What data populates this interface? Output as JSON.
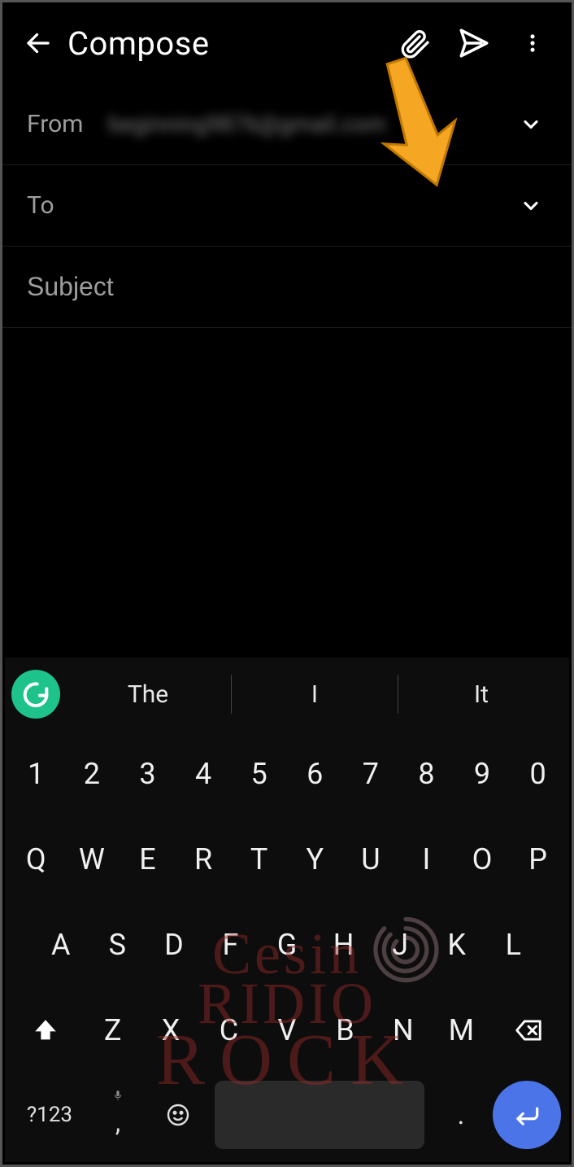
{
  "header": {
    "title": "Compose"
  },
  "fields": {
    "from_label": "From",
    "from_value": "beginning9876@gmail.com",
    "to_label": "To",
    "subject_placeholder": "Subject"
  },
  "suggestions": {
    "s1": "The",
    "s2": "I",
    "s3": "It"
  },
  "keys": {
    "row1": [
      "1",
      "2",
      "3",
      "4",
      "5",
      "6",
      "7",
      "8",
      "9",
      "0"
    ],
    "row2": [
      "Q",
      "W",
      "E",
      "R",
      "T",
      "Y",
      "U",
      "I",
      "O",
      "P"
    ],
    "row3": [
      "A",
      "S",
      "D",
      "F",
      "G",
      "H",
      "J",
      "K",
      "L"
    ],
    "row4": [
      "Z",
      "X",
      "C",
      "V",
      "B",
      "N",
      "M"
    ],
    "sym": "?123",
    "comma": ",",
    "dot": "."
  },
  "watermark": {
    "line1": "Cesin",
    "line2": "RIDIO",
    "line3": "ROCK"
  }
}
